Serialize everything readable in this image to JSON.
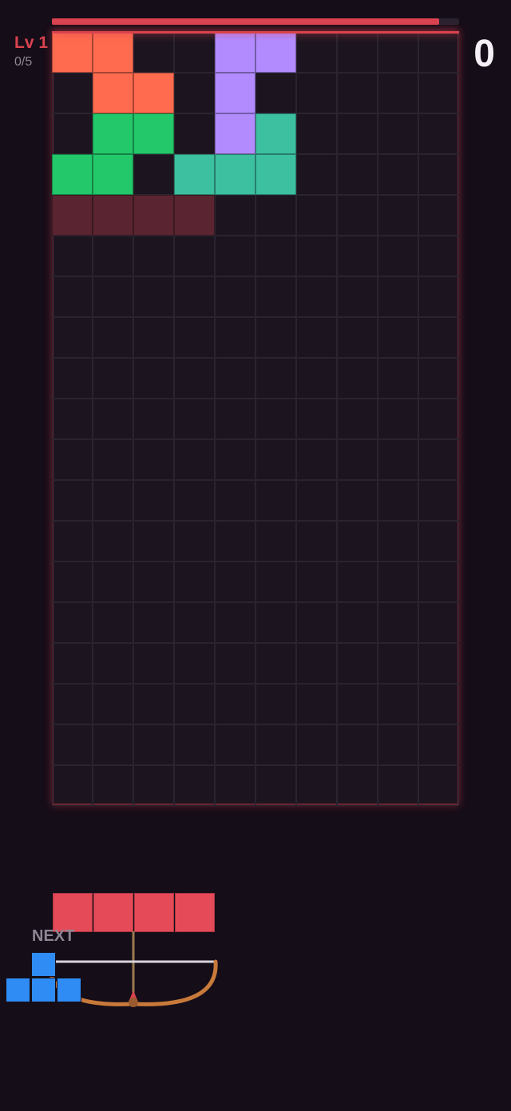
{
  "hud": {
    "level_label": "Lv 1",
    "lines_progress": "0/5",
    "score": "0",
    "progress_fraction": 0.95,
    "accent_color": "#d9434f"
  },
  "board": {
    "columns": 10,
    "rows": 19,
    "cells": [
      {
        "col": 0,
        "row": 0,
        "color": "#ff6b4f"
      },
      {
        "col": 1,
        "row": 0,
        "color": "#ff6b4f"
      },
      {
        "col": 4,
        "row": 0,
        "color": "#b28cff"
      },
      {
        "col": 5,
        "row": 0,
        "color": "#b28cff"
      },
      {
        "col": 1,
        "row": 1,
        "color": "#ff6b4f"
      },
      {
        "col": 2,
        "row": 1,
        "color": "#ff6b4f"
      },
      {
        "col": 4,
        "row": 1,
        "color": "#b28cff"
      },
      {
        "col": 1,
        "row": 2,
        "color": "#22c86a"
      },
      {
        "col": 2,
        "row": 2,
        "color": "#22c86a"
      },
      {
        "col": 4,
        "row": 2,
        "color": "#b28cff"
      },
      {
        "col": 5,
        "row": 2,
        "color": "#3cc0a0"
      },
      {
        "col": 0,
        "row": 3,
        "color": "#22c86a"
      },
      {
        "col": 1,
        "row": 3,
        "color": "#22c86a"
      },
      {
        "col": 3,
        "row": 3,
        "color": "#3cc0a0"
      },
      {
        "col": 4,
        "row": 3,
        "color": "#3cc0a0"
      },
      {
        "col": 5,
        "row": 3,
        "color": "#3cc0a0"
      }
    ],
    "ghost_cells": [
      {
        "col": 0,
        "row": 4
      },
      {
        "col": 1,
        "row": 4
      },
      {
        "col": 2,
        "row": 4
      },
      {
        "col": 3,
        "row": 4
      }
    ],
    "ghost_color": "#5a2430"
  },
  "current_piece": {
    "type": "I",
    "color": "#e54a58",
    "blocks": 4
  },
  "next_piece": {
    "label": "NEXT",
    "type": "T",
    "color": "#2f8cf5"
  },
  "launcher": {
    "icon": "bow-icon",
    "string_color": "#d9d4dc",
    "bow_color": "#c87a3a"
  }
}
